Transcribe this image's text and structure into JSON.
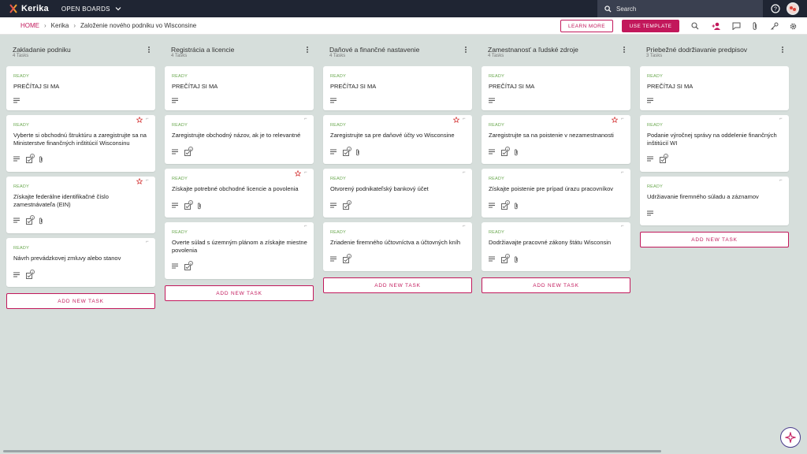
{
  "app": {
    "logo_text": "Kerika",
    "open_boards_label": "OPEN BOARDS",
    "search_placeholder": "Search",
    "accent": "#c2185b",
    "ready_color": "#6aa84f",
    "topbar_color": "#1f2533"
  },
  "breadcrumb": {
    "home": "HOME",
    "org": "Kerika",
    "board": "Založenie nového podniku vo Wisconsine"
  },
  "toolbar": {
    "learn_more": "LEARN MORE",
    "use_template": "USE TEMPLATE",
    "icons": [
      "search-icon",
      "add-person-icon",
      "chat-icon",
      "attachment-icon",
      "key-icon",
      "gear-icon"
    ]
  },
  "add_task_label": "ADD NEW TASK",
  "columns": [
    {
      "title": "Zakladanie podniku",
      "count": "4 Tasks",
      "cards": [
        {
          "status": "READY",
          "title": "PREČÍTAJ SI MA",
          "starred": false,
          "checklist": null,
          "attachment": false
        },
        {
          "status": "READY",
          "title": "Vyberte si obchodnú štruktúru a zaregistrujte sa na Ministerstve finančných inštitúcií Wisconsinu",
          "starred": true,
          "checklist": "8",
          "attachment": true
        },
        {
          "status": "READY",
          "title": "Získajte federálne identifikačné číslo zamestnávateľa (EIN)",
          "starred": true,
          "checklist": "3",
          "attachment": true
        },
        {
          "status": "READY",
          "title": "Návrh prevádzkovej zmluvy alebo stanov",
          "starred": false,
          "checklist": "4",
          "attachment": false
        }
      ]
    },
    {
      "title": "Registrácia a licencie",
      "count": "4 Tasks",
      "cards": [
        {
          "status": "READY",
          "title": "PREČÍTAJ SI MA",
          "starred": false,
          "checklist": null,
          "attachment": false
        },
        {
          "status": "READY",
          "title": "Zaregistrujte obchodný názov, ak je to relevantné",
          "starred": false,
          "checklist": "4",
          "attachment": false
        },
        {
          "status": "READY",
          "title": "Získajte potrebné obchodné licencie a povolenia",
          "starred": true,
          "checklist": "3",
          "attachment": true
        },
        {
          "status": "READY",
          "title": "Overte súlad s územným plánom a získajte miestne povolenia",
          "starred": false,
          "checklist": "4",
          "attachment": false
        }
      ]
    },
    {
      "title": "Daňové a finančné nastavenie",
      "count": "4 Tasks",
      "cards": [
        {
          "status": "READY",
          "title": "PREČÍTAJ SI MA",
          "starred": false,
          "checklist": null,
          "attachment": false
        },
        {
          "status": "READY",
          "title": "Zaregistrujte sa pre daňové účty vo Wisconsine",
          "starred": true,
          "checklist": "4",
          "attachment": true
        },
        {
          "status": "READY",
          "title": "Otvorený podnikateľský bankový účet",
          "starred": false,
          "checklist": "3",
          "attachment": false
        },
        {
          "status": "READY",
          "title": "Zriadenie firemného účtovníctva a účtovných kníh",
          "starred": false,
          "checklist": "4",
          "attachment": false
        }
      ]
    },
    {
      "title": "Zamestnanosť a ľudské zdroje",
      "count": "4 Tasks",
      "cards": [
        {
          "status": "READY",
          "title": "PREČÍTAJ SI MA",
          "starred": false,
          "checklist": null,
          "attachment": false
        },
        {
          "status": "READY",
          "title": "Zaregistrujte sa na poistenie v nezamestnanosti",
          "starred": true,
          "checklist": "4",
          "attachment": true
        },
        {
          "status": "READY",
          "title": "Získajte poistenie pre prípad úrazu pracovníkov",
          "starred": false,
          "checklist": "3",
          "attachment": true
        },
        {
          "status": "READY",
          "title": "Dodržiavajte pracovné zákony štátu Wisconsin",
          "starred": false,
          "checklist": "4",
          "attachment": true
        }
      ]
    },
    {
      "title": "Priebežné dodržiavanie predpisov",
      "count": "3 Tasks",
      "cards": [
        {
          "status": "READY",
          "title": "PREČÍTAJ SI MA",
          "starred": false,
          "checklist": null,
          "attachment": false
        },
        {
          "status": "READY",
          "title": "Podanie výročnej správy na oddelenie finančných inštitúcií WI",
          "starred": false,
          "checklist": "4",
          "attachment": false
        },
        {
          "status": "READY",
          "title": "Udržiavanie firemného súladu a záznamov",
          "starred": false,
          "checklist": null,
          "attachment": false
        }
      ]
    }
  ]
}
